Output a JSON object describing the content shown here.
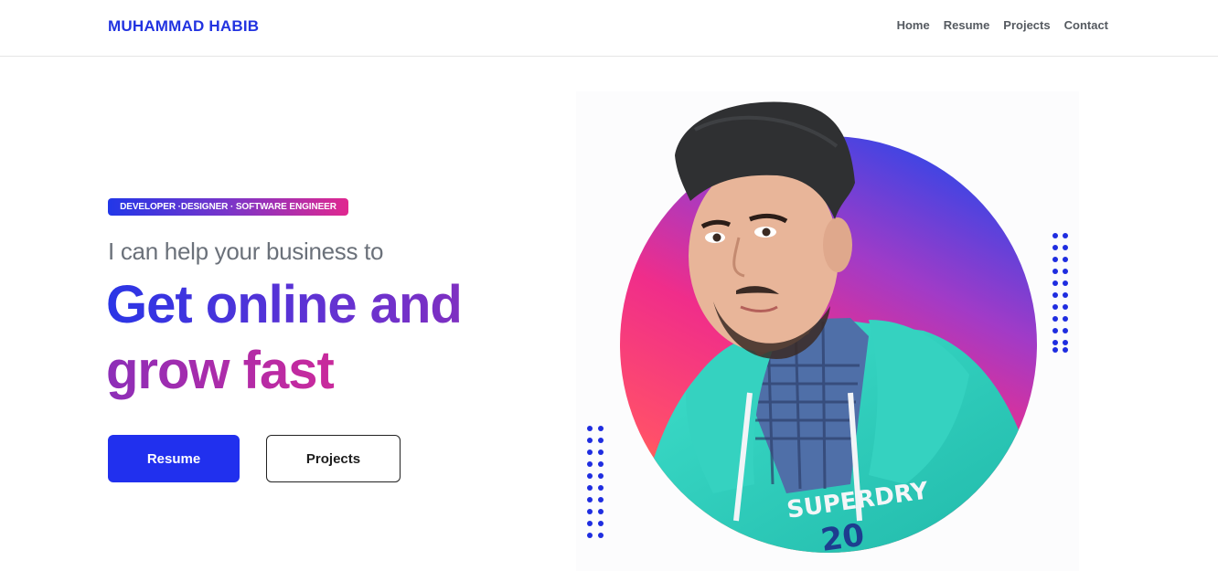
{
  "brand": {
    "name": "MUHAMMAD HABIB"
  },
  "nav": {
    "items": [
      {
        "label": "Home"
      },
      {
        "label": "Resume"
      },
      {
        "label": "Projects"
      },
      {
        "label": "Contact"
      }
    ]
  },
  "hero": {
    "badge": "DEVELOPER ·DESIGNER · SOFTWARE ENGINEER",
    "subtitle": "I can help your business to",
    "headline_line1": "Get online and",
    "headline_line2": "grow fast",
    "primary_button": "Resume",
    "secondary_button": "Projects",
    "portrait_hoodie_text": "SUPERDRY"
  },
  "colors": {
    "brand_blue": "#2233e0",
    "button_blue": "#2130ee",
    "gradient_start": "#2237e8",
    "gradient_mid": "#7a35c9",
    "gradient_end": "#e0288f",
    "dot_blue": "#1f2de0"
  }
}
